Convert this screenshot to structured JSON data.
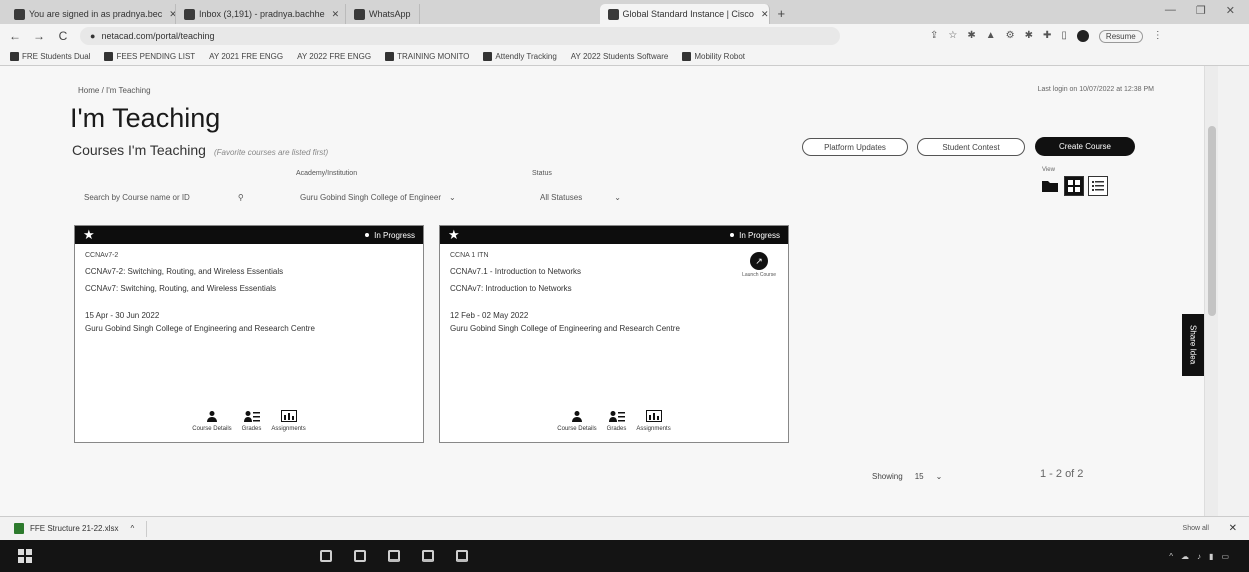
{
  "browser": {
    "tabs": [
      {
        "title": "You are signed in as pradnya.bec",
        "active": false
      },
      {
        "title": "Inbox (3,191) - pradnya.bachhe",
        "active": false
      },
      {
        "title": "WhatsApp",
        "active": true
      },
      {
        "title": "Global Standard Instance | Cisco",
        "active": false
      }
    ],
    "url": "netacad.com/portal/teaching",
    "resume_label": "Resume",
    "bookmarks": [
      "FRE Students Dual",
      "FEES PENDING LIST",
      "AY 2021 FRE ENGG",
      "AY 2022 FRE ENGG",
      "TRAINING MONITO",
      "Attendly Tracking",
      "AY 2022 Students Software",
      "Mobility Robot"
    ]
  },
  "page": {
    "breadcrumb": "Home / I'm Teaching",
    "last_login": "Last login on 10/07/2022 at 12:38 PM",
    "title": "I'm Teaching",
    "section_title": "Courses I'm Teaching",
    "section_note": "(Favorite courses are listed first)",
    "buttons": {
      "platform_updates": "Platform Updates",
      "student_contest": "Student Contest",
      "create_course": "Create Course"
    },
    "filters": {
      "search_placeholder": "Search by Course name or ID",
      "academy_label": "Academy/Institution",
      "academy_value": "Guru Gobind Singh College of Engineer",
      "status_label": "Status",
      "status_value": "All Statuses"
    },
    "view_label": "View",
    "share_idea": "Share Idea",
    "showing_label": "Showing",
    "showing_value": "15",
    "pagination": "1 - 2 of 2"
  },
  "courses": [
    {
      "status": "In Progress",
      "code": "CCNAv7-2",
      "name": "CCNAv7-2: Switching, Routing, and Wireless Essentials",
      "full_name": "CCNAv7: Switching, Routing, and Wireless Essentials",
      "dates": "15 Apr - 30 Jun 2022",
      "institution": "Guru Gobind Singh College of Engineering and Research Centre",
      "has_launch": false
    },
    {
      "status": "In Progress",
      "code": "CCNA 1 ITN",
      "name": "CCNAv7.1 - Introduction to Networks",
      "full_name": "CCNAv7: Introduction to Networks",
      "dates": "12 Feb - 02 May 2022",
      "institution": "Guru Gobind Singh College of Engineering and Research Centre",
      "has_launch": true,
      "launch_label": "Launch Course"
    }
  ],
  "card_actions": {
    "details": "Course Details",
    "grades": "Grades",
    "assignments": "Assignments"
  },
  "downloads": {
    "file": "FFE Structure 21-22.xlsx",
    "show_all": "Show all"
  }
}
